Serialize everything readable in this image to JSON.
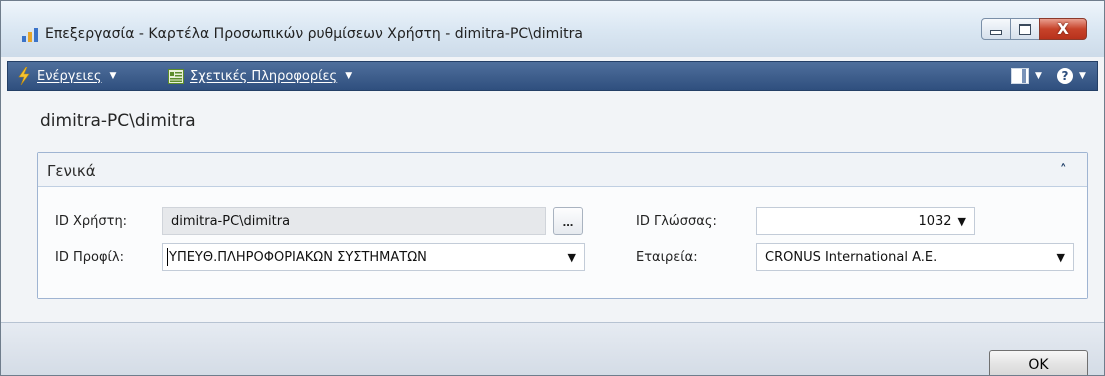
{
  "window": {
    "title": "Επεξεργασία - Καρτέλα Προσωπικών ρυθμίσεων Χρήστη - dimitra-PC\\dimitra",
    "buttons": {
      "minimize": "minimize",
      "maximize": "maximize",
      "close": "X"
    }
  },
  "actionbar": {
    "actions_label": "Ενέργειες",
    "related_label": "Σχετικές Πληροφορίες",
    "icons": [
      "lightning-bolt-icon",
      "related-info-icon",
      "layout-icon",
      "help-icon"
    ],
    "help_glyph": "?"
  },
  "record": {
    "title": "dimitra-PC\\dimitra"
  },
  "general_tab": {
    "title": "Γενικά",
    "collapse_glyph": "^",
    "fields": {
      "user_id": {
        "label": "ID Χρήστη:",
        "value": "dimitra-PC\\dimitra",
        "lookup": "..."
      },
      "profile_id": {
        "label": "ID Προφίλ:",
        "value": "ΥΠΕΥΘ.ΠΛΗΡΟΦΟΡΙΑΚΩΝ ΣΥΣΤΗΜΑΤΩΝ"
      },
      "language_id": {
        "label": "ID Γλώσσας:",
        "value": "1032"
      },
      "company": {
        "label": "Εταιρεία:",
        "value": "CRONUS International A.E."
      }
    }
  },
  "footer": {
    "ok_label": "OK"
  },
  "colors": {
    "actionbar": "#2f4f7e",
    "fasttab_border": "#9fb4d2",
    "close_button": "#c7432a"
  }
}
